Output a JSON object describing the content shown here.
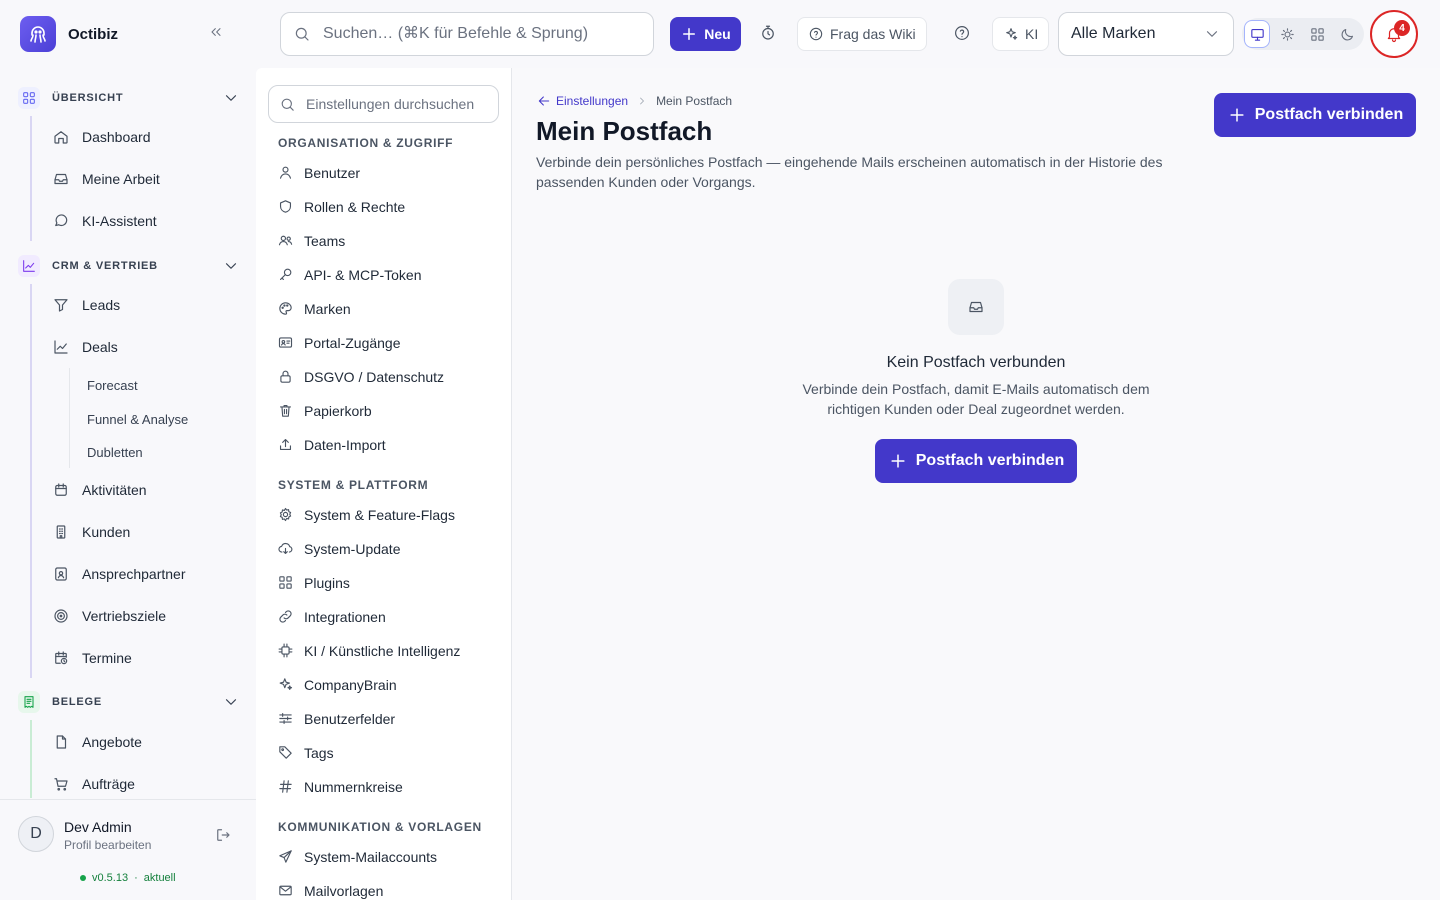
{
  "app": {
    "name": "Octibiz"
  },
  "topbar": {
    "search_placeholder": "Suchen… (⌘K für Befehle & Sprung)",
    "new_label": "Neu",
    "wiki_label": "Frag das Wiki",
    "ai_label": "KI",
    "brand_select_value": "Alle Marken",
    "notification_count": "4",
    "view_modes": [
      "monitor-icon",
      "sun-icon",
      "grid-icon",
      "moon-icon"
    ],
    "active_view_mode": "monitor-icon"
  },
  "sidebar": {
    "sections": [
      {
        "label": "ÜBERSICHT",
        "icon": "grid-icon",
        "color": "#6366f1",
        "items": [
          {
            "label": "Dashboard",
            "icon": "home-icon"
          },
          {
            "label": "Meine Arbeit",
            "icon": "inbox-icon"
          },
          {
            "label": "KI-Assistent",
            "icon": "chat-icon"
          }
        ]
      },
      {
        "label": "CRM & VERTRIEB",
        "icon": "chart-icon",
        "color": "#7c3aed",
        "items": [
          {
            "label": "Leads",
            "icon": "funnel-icon"
          },
          {
            "label": "Deals",
            "icon": "trend-icon"
          },
          {
            "label": "Aktivitäten",
            "icon": "calendar-icon"
          },
          {
            "label": "Kunden",
            "icon": "building-icon"
          },
          {
            "label": "Ansprechpartner",
            "icon": "contact-icon"
          },
          {
            "label": "Vertriebsziele",
            "icon": "target-icon"
          },
          {
            "label": "Termine",
            "icon": "calendar-clock-icon"
          }
        ],
        "deal_subitems": [
          "Forecast",
          "Funnel & Analyse",
          "Dubletten"
        ]
      },
      {
        "label": "BELEGE",
        "icon": "receipt-icon",
        "color": "#16a34a",
        "items": [
          {
            "label": "Angebote",
            "icon": "file-icon"
          },
          {
            "label": "Aufträge",
            "icon": "cart-icon"
          }
        ]
      }
    ],
    "user": {
      "initial": "D",
      "name": "Dev Admin",
      "profile_link": "Profil bearbeiten"
    },
    "version": "v0.5.13",
    "version_status": "aktuell"
  },
  "settings_nav": {
    "search_placeholder": "Einstellungen durchsuchen",
    "groups": [
      {
        "label": "ORGANISATION & ZUGRIFF",
        "items": [
          {
            "label": "Benutzer",
            "icon": "user-icon"
          },
          {
            "label": "Rollen & Rechte",
            "icon": "shield-icon"
          },
          {
            "label": "Teams",
            "icon": "users-icon"
          },
          {
            "label": "API- & MCP-Token",
            "icon": "key-icon"
          },
          {
            "label": "Marken",
            "icon": "palette-icon"
          },
          {
            "label": "Portal-Zugänge",
            "icon": "id-card-icon"
          },
          {
            "label": "DSGVO / Datenschutz",
            "icon": "lock-icon"
          },
          {
            "label": "Papierkorb",
            "icon": "trash-icon"
          },
          {
            "label": "Daten-Import",
            "icon": "upload-icon"
          }
        ]
      },
      {
        "label": "SYSTEM & PLATTFORM",
        "items": [
          {
            "label": "System & Feature-Flags",
            "icon": "gear-icon"
          },
          {
            "label": "System-Update",
            "icon": "cloud-download-icon"
          },
          {
            "label": "Plugins",
            "icon": "grid-icon"
          },
          {
            "label": "Integrationen",
            "icon": "link-icon"
          },
          {
            "label": "KI / Künstliche Intelligenz",
            "icon": "chip-icon"
          },
          {
            "label": "CompanyBrain",
            "icon": "sparkle-icon"
          },
          {
            "label": "Benutzerfelder",
            "icon": "sliders-icon"
          },
          {
            "label": "Tags",
            "icon": "tag-icon"
          },
          {
            "label": "Nummernkreise",
            "icon": "hash-icon"
          }
        ]
      },
      {
        "label": "KOMMUNIKATION & VORLAGEN",
        "items": [
          {
            "label": "System-Mailaccounts",
            "icon": "send-icon"
          },
          {
            "label": "Mailvorlagen",
            "icon": "mail-icon"
          }
        ]
      }
    ]
  },
  "main": {
    "breadcrumb": {
      "back_label": "Einstellungen",
      "current": "Mein Postfach"
    },
    "title": "Mein Postfach",
    "description": "Verbinde dein persönliches Postfach — eingehende Mails erscheinen automatisch in der Historie des passenden Kunden oder Vorgangs.",
    "header_button": "Postfach verbinden",
    "empty_state": {
      "icon": "inbox-icon",
      "title": "Kein Postfach verbunden",
      "description": "Verbinde dein Postfach, damit E-Mails automatisch dem richtigen Kunden oder Deal zugeordnet werden.",
      "button": "Postfach verbinden"
    }
  },
  "colors": {
    "accent": "#4338ca",
    "notification": "#dc2626",
    "status_ok": "#16a34a"
  }
}
